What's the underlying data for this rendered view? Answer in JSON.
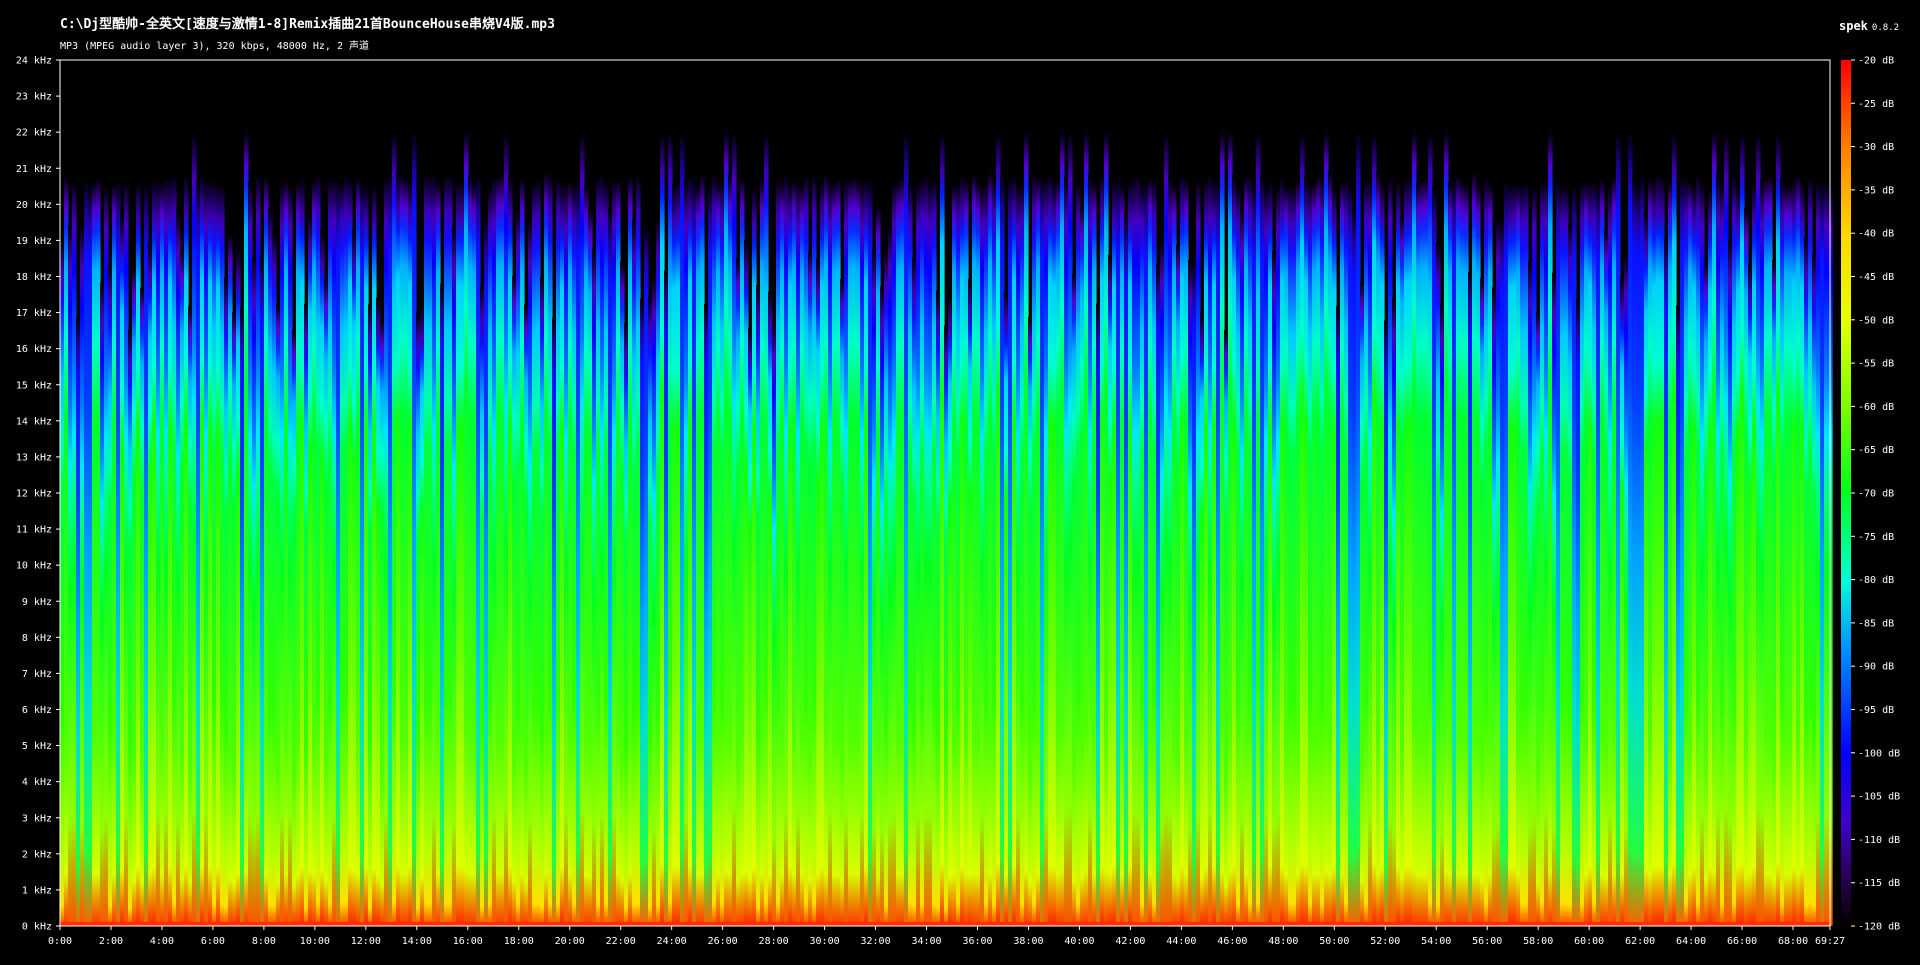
{
  "window": {
    "title": "C:\\Dj型酷帅-全英文[速度与激情1-8]Remix插曲21首BounceHouse串烧V4版.mp3",
    "file_info": "MP3 (MPEG audio layer 3), 320 kbps, 48000 Hz, 2 声道"
  },
  "app": {
    "name": "spek",
    "version": "0.8.2"
  },
  "chart_data": {
    "type": "heatmap",
    "title": "",
    "xlabel": "",
    "ylabel": "",
    "x_ticks": [
      "0:00",
      "2:00",
      "4:00",
      "6:00",
      "8:00",
      "10:00",
      "12:00",
      "14:00",
      "16:00",
      "18:00",
      "20:00",
      "22:00",
      "24:00",
      "26:00",
      "28:00",
      "30:00",
      "32:00",
      "34:00",
      "36:00",
      "38:00",
      "40:00",
      "42:00",
      "44:00",
      "46:00",
      "48:00",
      "50:00",
      "52:00",
      "54:00",
      "56:00",
      "58:00",
      "60:00",
      "62:00",
      "64:00",
      "66:00",
      "68:00",
      "69:27"
    ],
    "x_tick_seconds": [
      0,
      120,
      240,
      360,
      480,
      600,
      720,
      840,
      960,
      1080,
      1200,
      1320,
      1440,
      1560,
      1680,
      1800,
      1920,
      2040,
      2160,
      2280,
      2400,
      2520,
      2640,
      2760,
      2880,
      3000,
      3120,
      3240,
      3360,
      3480,
      3600,
      3720,
      3840,
      3960,
      4080,
      4167
    ],
    "duration_seconds": 4167,
    "y_ticks": [
      "0 kHz",
      "1 kHz",
      "2 kHz",
      "3 kHz",
      "4 kHz",
      "5 kHz",
      "6 kHz",
      "7 kHz",
      "8 kHz",
      "9 kHz",
      "10 kHz",
      "11 kHz",
      "12 kHz",
      "13 kHz",
      "14 kHz",
      "15 kHz",
      "16 kHz",
      "17 kHz",
      "18 kHz",
      "19 kHz",
      "20 kHz",
      "21 kHz",
      "22 kHz",
      "23 kHz",
      "24 kHz"
    ],
    "y_tick_values_khz": [
      0,
      1,
      2,
      3,
      4,
      5,
      6,
      7,
      8,
      9,
      10,
      11,
      12,
      13,
      14,
      15,
      16,
      17,
      18,
      19,
      20,
      21,
      22,
      23,
      24
    ],
    "ylim_khz": [
      0,
      24
    ],
    "colorbar_ticks": [
      "-20 dB",
      "-25 dB",
      "-30 dB",
      "-35 dB",
      "-40 dB",
      "-45 dB",
      "-50 dB",
      "-55 dB",
      "-60 dB",
      "-65 dB",
      "-70 dB",
      "-75 dB",
      "-80 dB",
      "-85 dB",
      "-90 dB",
      "-95 dB",
      "-100 dB",
      "-105 dB",
      "-110 dB",
      "-115 dB",
      "-120 dB"
    ],
    "colorbar_tick_values_db": [
      -20,
      -25,
      -30,
      -35,
      -40,
      -45,
      -50,
      -55,
      -60,
      -65,
      -70,
      -75,
      -80,
      -85,
      -90,
      -95,
      -100,
      -105,
      -110,
      -115,
      -120
    ],
    "colorbar_range_db": [
      -120,
      -20
    ],
    "colorbar_colors": [
      "#ff0000",
      "#ff7f00",
      "#ffd700",
      "#e6ff00",
      "#7cff00",
      "#00ff20",
      "#00ffd8",
      "#0090ff",
      "#0000ff",
      "#4000c8",
      "#200038",
      "#000000"
    ],
    "colorbar_stops_db": [
      -20,
      -30,
      -40,
      -50,
      -60,
      -70,
      -80,
      -88,
      -100,
      -108,
      -116,
      -120
    ],
    "spectral_cutoff_khz": [
      22,
      20.5,
      16.5
    ],
    "grid": false,
    "legend": "right"
  }
}
